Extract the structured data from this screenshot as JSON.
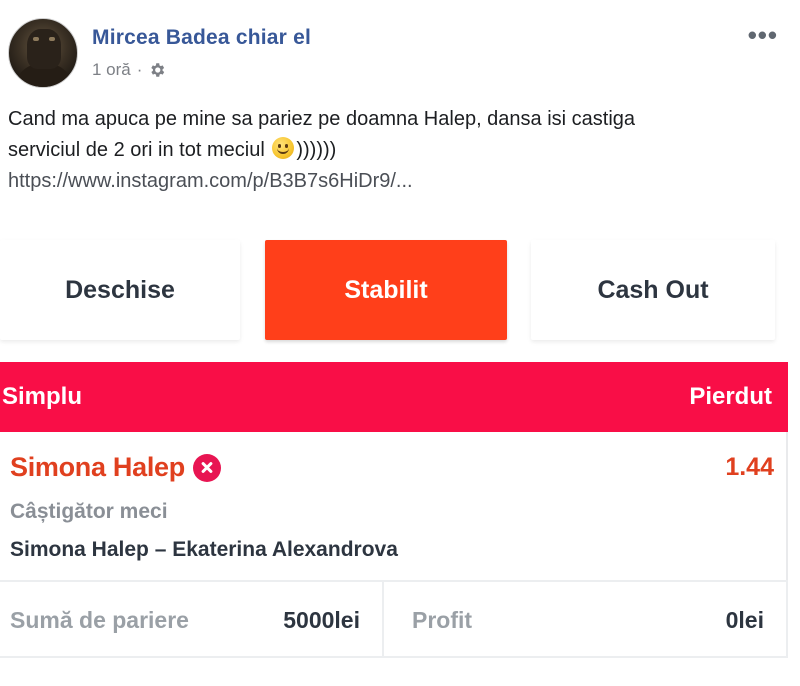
{
  "post": {
    "author": "Mircea Badea chiar el",
    "time": "1 oră",
    "separator": "·",
    "privacy_icon": "gear-icon",
    "more_label": "•••",
    "text_line1": "Cand ma apuca pe mine sa pariez pe doamna Halep, dansa isi castiga",
    "text_line2_before": "serviciul de 2 ori in tot meciul",
    "emoji": "smile-emoji",
    "text_line2_after": "))))))",
    "link": "https://www.instagram.com/p/B3B7s6HiDr9/..."
  },
  "tabs": [
    {
      "label": "Deschise",
      "active": false
    },
    {
      "label": "Stabilit",
      "active": true
    },
    {
      "label": "Cash Out",
      "active": false
    }
  ],
  "bet": {
    "type": "Simplu",
    "status": "Pierdut",
    "selection": "Simona Halep",
    "result_icon": "lost-x-icon",
    "odds": "1.44",
    "market": "Câștigător meci",
    "event": "Simona Halep – Ekaterina Alexandrova",
    "stake_label": "Sumă de pariere",
    "stake_value": "5000lei",
    "profit_label": "Profit",
    "profit_value": "0lei"
  },
  "colors": {
    "author_blue": "#385898",
    "active_tab": "#ff3f1a",
    "header_red": "#f90e47",
    "selection_orange": "#e0401f",
    "lost_icon": "#e81552"
  }
}
